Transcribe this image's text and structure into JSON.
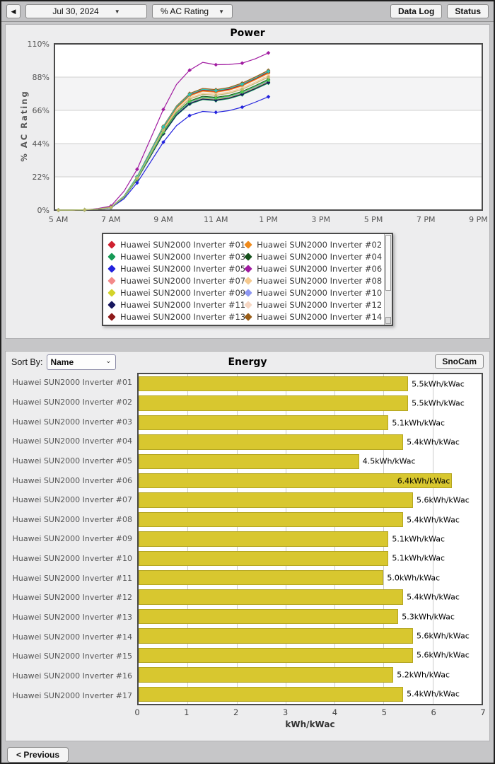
{
  "toolbar": {
    "back_glyph": "◀",
    "date_label": "Jul 30, 2024",
    "metric_label": "% AC Rating",
    "dropdown_glyph": "▼",
    "data_log_label": "Data Log",
    "status_label": "Status"
  },
  "energy": {
    "sort_by_label": "Sort By:",
    "sort_value": "Name",
    "snocam_label": "SnoCam",
    "select_caret_glyph": "⌄"
  },
  "footer": {
    "previous_label": "< Previous"
  },
  "colors": {
    "bar_fill": "#d8c72f",
    "band_gray": "#f4f4f5",
    "gridline": "#cfcfcf",
    "plot_border": "#4a4a4a"
  },
  "chart_data": [
    {
      "type": "line",
      "title": "Power",
      "ylabel": "% AC Rating",
      "xlabel": "",
      "ylim": [
        0,
        110
      ],
      "ytick_values": [
        0,
        22,
        44,
        66,
        88,
        110
      ],
      "ytick_labels": [
        "0%",
        "22%",
        "44%",
        "66%",
        "88%",
        "110%"
      ],
      "xticks": [
        {
          "h": 5,
          "label": "5 AM"
        },
        {
          "h": 7,
          "label": "7 AM"
        },
        {
          "h": 9,
          "label": "9 AM"
        },
        {
          "h": 11,
          "label": "11 AM"
        },
        {
          "h": 13,
          "label": "1 PM"
        },
        {
          "h": 15,
          "label": "3 PM"
        },
        {
          "h": 17,
          "label": "5 PM"
        },
        {
          "h": 19,
          "label": "7 PM"
        },
        {
          "h": 21,
          "label": "9 PM"
        }
      ],
      "x_hours": [
        5,
        5.5,
        6,
        6.5,
        7,
        7.5,
        8,
        8.5,
        9,
        9.5,
        10,
        10.5,
        11,
        11.5,
        12,
        12.5,
        13
      ],
      "legend_visible": 14,
      "series": [
        {
          "name": "Huawei SUN2000 Inverter #01",
          "color": "#cf2130",
          "values": [
            0,
            0,
            0.2,
            0.7,
            1.8,
            9.1,
            21.8,
            38.2,
            54.6,
            67.8,
            76,
            79.2,
            78.4,
            79.8,
            82.6,
            86.6,
            91
          ]
        },
        {
          "name": "Huawei SUN2000 Inverter #02",
          "color": "#ef8a1c",
          "values": [
            0,
            0,
            0.2,
            0.7,
            1.8,
            9.1,
            21.7,
            38,
            54.3,
            67.4,
            75.6,
            78.7,
            78,
            79.4,
            82.2,
            86.2,
            90.5
          ]
        },
        {
          "name": "Huawei SUN2000 Inverter #03",
          "color": "#169a56",
          "values": [
            0,
            0,
            0.2,
            0.7,
            1.7,
            8.4,
            20.2,
            35.3,
            50.4,
            62.6,
            70.1,
            73.1,
            72.4,
            73.7,
            76.3,
            80,
            84
          ]
        },
        {
          "name": "Huawei SUN2000 Inverter #04",
          "color": "#15511c",
          "values": [
            0,
            0,
            0.2,
            0.7,
            1.7,
            8.7,
            20.8,
            36.3,
            51.9,
            64.4,
            72.2,
            75.3,
            74.6,
            75.9,
            78.5,
            82.3,
            86.5
          ]
        },
        {
          "name": "Huawei SUN2000 Inverter #05",
          "color": "#2222dd",
          "values": [
            0,
            0,
            0.2,
            0.6,
            1.5,
            7.5,
            18,
            31.5,
            45,
            55.9,
            62.6,
            65.3,
            64.7,
            65.8,
            68.1,
            71.4,
            75
          ]
        },
        {
          "name": "Huawei SUN2000 Inverter #06",
          "color": "#a11ba1",
          "values": [
            0,
            0,
            0.2,
            1,
            2.6,
            12.5,
            27,
            46.8,
            66.6,
            83.2,
            92.6,
            97.8,
            96.2,
            96.4,
            97.2,
            100.1,
            104
          ]
        },
        {
          "name": "Huawei SUN2000 Inverter #07",
          "color": "#f38a8a",
          "values": [
            0,
            0,
            0.2,
            0.7,
            1.8,
            9.2,
            22.1,
            38.6,
            55.2,
            68.5,
            76.8,
            80,
            79.3,
            80.7,
            83.5,
            87.6,
            92
          ]
        },
        {
          "name": "Huawei SUN2000 Inverter #08",
          "color": "#f5c98f",
          "values": [
            0,
            0,
            0.2,
            0.7,
            1.8,
            8.9,
            21.4,
            37.4,
            53.4,
            66.3,
            74.3,
            77.4,
            76.7,
            78.1,
            80.8,
            84.7,
            89
          ]
        },
        {
          "name": "Huawei SUN2000 Inverter #09",
          "color": "#d3d32a",
          "values": [
            0,
            0,
            0.2,
            0.7,
            1.7,
            8.5,
            20.4,
            35.7,
            51,
            63.3,
            71,
            74,
            73.3,
            74.5,
            77.2,
            80.9,
            85
          ]
        },
        {
          "name": "Huawei SUN2000 Inverter #10",
          "color": "#8e97f2",
          "values": [
            0,
            0,
            0.2,
            0.7,
            1.7,
            8.6,
            20.5,
            35.9,
            51.3,
            63.7,
            71.4,
            74.4,
            73.7,
            75,
            77.6,
            81.4,
            85.5
          ]
        },
        {
          "name": "Huawei SUN2000 Inverter #11",
          "color": "#17175f",
          "values": [
            0,
            0,
            0.2,
            0.7,
            1.7,
            8.5,
            20.3,
            35.5,
            50.7,
            63,
            70.6,
            73.5,
            72.8,
            74.1,
            76.7,
            80.4,
            84.5
          ]
        },
        {
          "name": "Huawei SUN2000 Inverter #12",
          "color": "#f7d7c3",
          "values": [
            0,
            0,
            0.2,
            0.7,
            1.8,
            8.9,
            21.2,
            37.2,
            53.1,
            65.9,
            73.9,
            77,
            76.3,
            77.6,
            80.4,
            84.3,
            88.5
          ]
        },
        {
          "name": "Huawei SUN2000 Inverter #13",
          "color": "#8f1a1a",
          "values": [
            0,
            0,
            0.2,
            0.7,
            1.8,
            9.2,
            22,
            38.4,
            54.9,
            68.2,
            76.4,
            79.6,
            78.9,
            80.2,
            83.1,
            87.1,
            91.5
          ]
        },
        {
          "name": "Huawei SUN2000 Inverter #14",
          "color": "#9a5d17",
          "values": [
            0,
            0,
            0.2,
            0.7,
            1.9,
            9.3,
            22.2,
            38.9,
            55.5,
            68.9,
            77.2,
            80.5,
            79.7,
            81.1,
            84,
            88.1,
            92.5
          ]
        },
        {
          "name": "Huawei SUN2000 Inverter #15",
          "color": "#2cc5b7",
          "values": [
            0,
            0,
            0.2,
            0.7,
            1.8,
            9.2,
            22,
            38.5,
            55.1,
            68.4,
            76.6,
            79.9,
            79.1,
            80.5,
            83.3,
            87.4,
            91.8
          ]
        },
        {
          "name": "Huawei SUN2000 Inverter #16",
          "color": "#4ccc4c",
          "values": [
            0,
            0,
            0.2,
            0.7,
            1.7,
            8.6,
            20.6,
            36.1,
            51.6,
            64.1,
            71.8,
            74.8,
            74.1,
            75.4,
            78.1,
            81.9,
            86
          ]
        },
        {
          "name": "Huawei SUN2000 Inverter #17",
          "color": "#bdb76b",
          "values": [
            0,
            0,
            0.2,
            0.7,
            1.8,
            8.8,
            21.1,
            37,
            52.8,
            65.6,
            73.5,
            76.6,
            75.9,
            77.2,
            79.9,
            83.8,
            88
          ]
        }
      ]
    },
    {
      "type": "bar",
      "orientation": "horizontal",
      "title": "Energy",
      "xlabel": "kWh/kWac",
      "unit_suffix": "kWh/kWac",
      "xlim": [
        0,
        7
      ],
      "xticks": [
        0,
        1,
        2,
        3,
        4,
        5,
        6,
        7
      ],
      "inside_label_threshold": 6.2,
      "categories": [
        "Huawei SUN2000 Inverter #01",
        "Huawei SUN2000 Inverter #02",
        "Huawei SUN2000 Inverter #03",
        "Huawei SUN2000 Inverter #04",
        "Huawei SUN2000 Inverter #05",
        "Huawei SUN2000 Inverter #06",
        "Huawei SUN2000 Inverter #07",
        "Huawei SUN2000 Inverter #08",
        "Huawei SUN2000 Inverter #09",
        "Huawei SUN2000 Inverter #10",
        "Huawei SUN2000 Inverter #11",
        "Huawei SUN2000 Inverter #12",
        "Huawei SUN2000 Inverter #13",
        "Huawei SUN2000 Inverter #14",
        "Huawei SUN2000 Inverter #15",
        "Huawei SUN2000 Inverter #16",
        "Huawei SUN2000 Inverter #17"
      ],
      "values": [
        5.5,
        5.5,
        5.1,
        5.4,
        4.5,
        6.4,
        5.6,
        5.4,
        5.1,
        5.1,
        5.0,
        5.4,
        5.3,
        5.6,
        5.6,
        5.2,
        5.4
      ]
    }
  ]
}
